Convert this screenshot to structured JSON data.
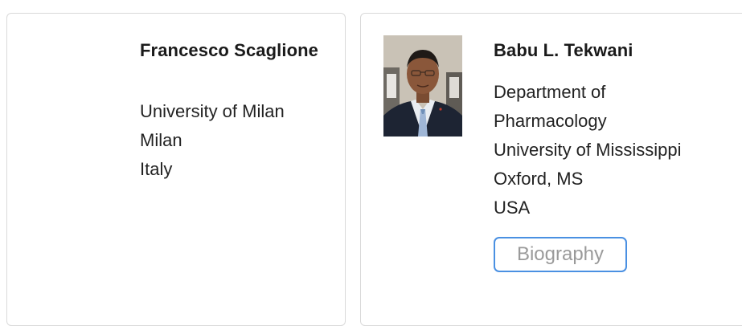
{
  "people": [
    {
      "name": "Francesco Scaglione",
      "affiliation": [
        "University of Milan",
        "Milan",
        "Italy"
      ]
    },
    {
      "name": "Babu L. Tekwani",
      "photo_alt": "Babu L. Tekwani",
      "affiliation": [
        "Department of",
        "Pharmacology",
        "University of Mississippi",
        "Oxford, MS",
        "USA"
      ],
      "biography_label": "Biography"
    }
  ],
  "colors": {
    "card_border": "#d9d9d9",
    "button_border": "#4a90e2",
    "button_text": "#9a9a9a"
  }
}
